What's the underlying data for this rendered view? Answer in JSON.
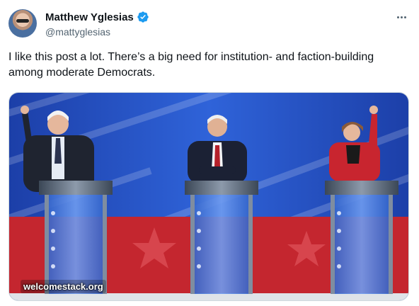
{
  "author": {
    "display_name": "Matthew Yglesias",
    "handle": "@mattyglesias",
    "verified": true
  },
  "icons": {
    "verified": "verified-badge-icon",
    "more": "more-options-icon"
  },
  "colors": {
    "verified_badge": "#1d9bf0",
    "text": "#0f1419",
    "secondary_text": "#536471"
  },
  "post": {
    "text": "I like this post a lot. There’s a big need for institution- and faction-building among moderate Democrats."
  },
  "media": {
    "watermark": "welcomestack.org"
  }
}
